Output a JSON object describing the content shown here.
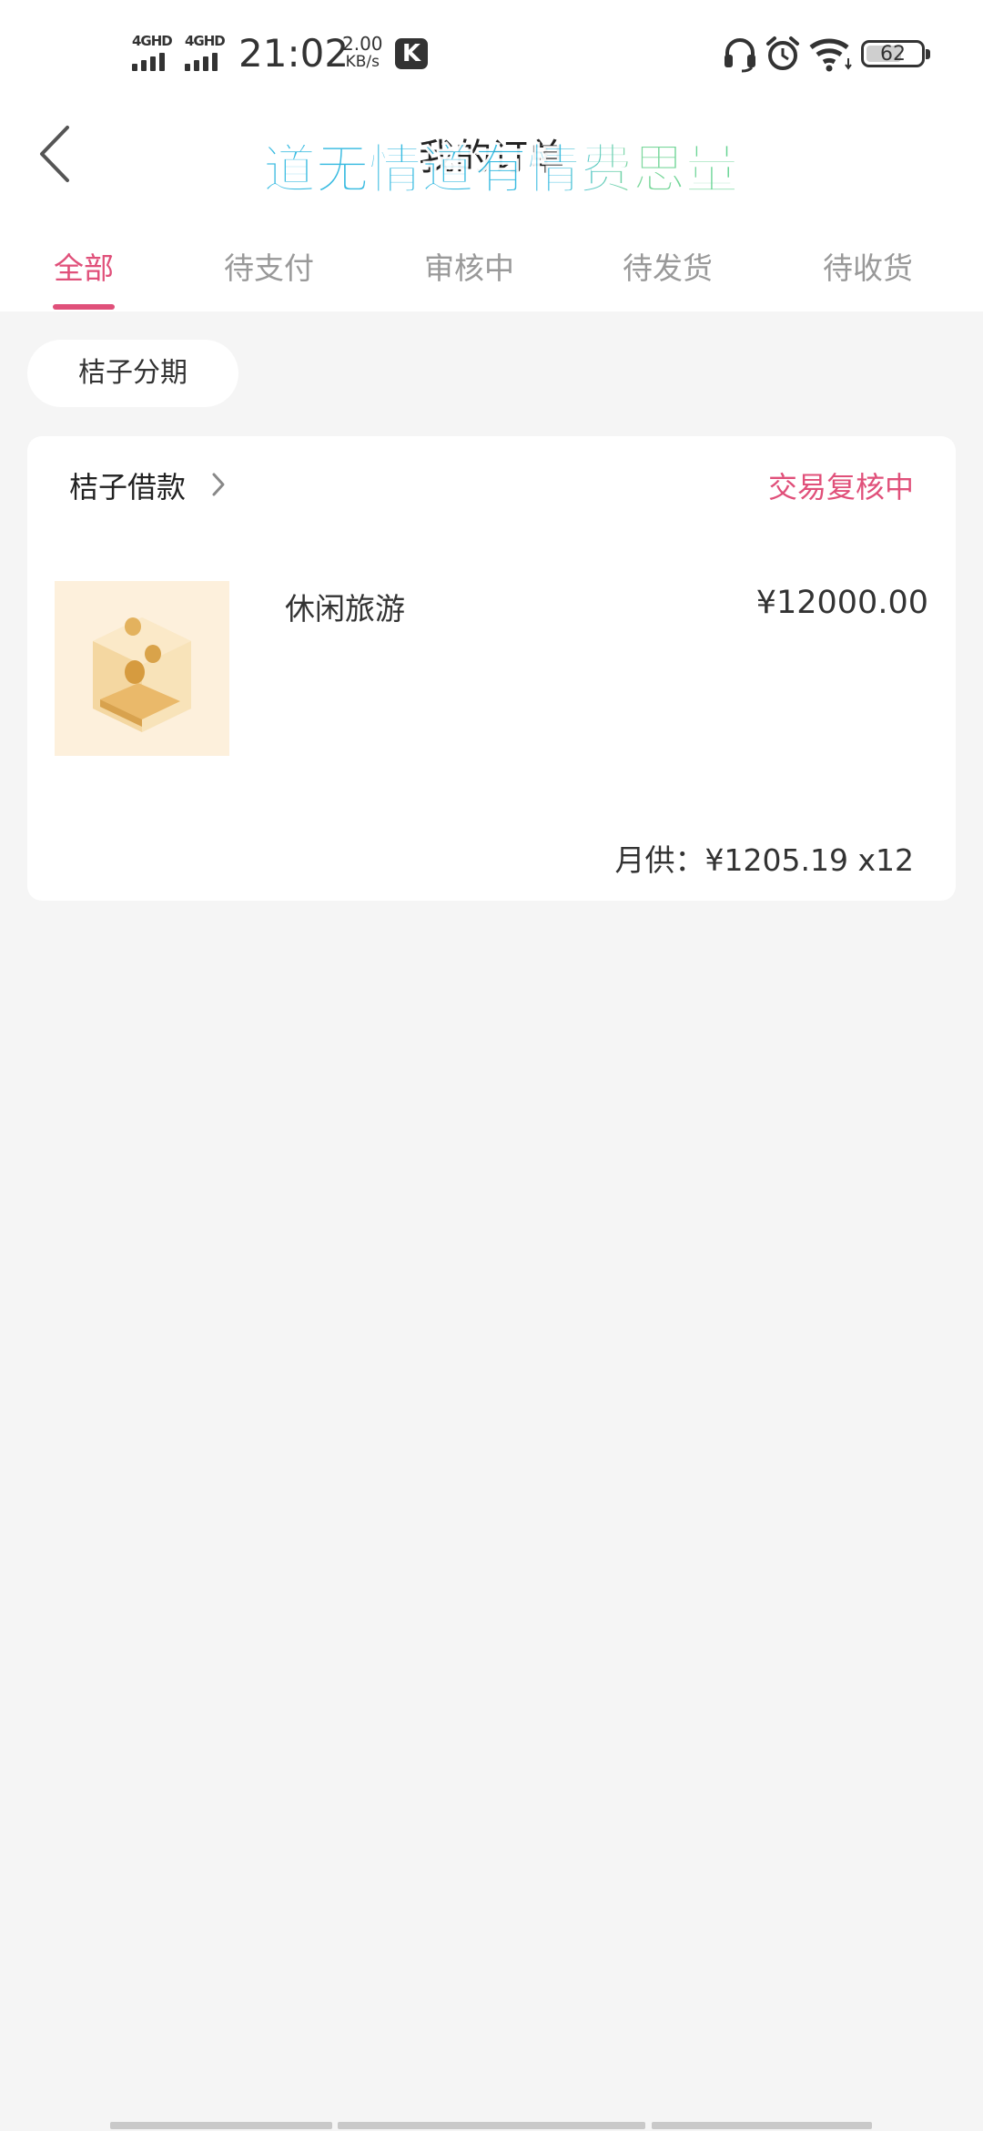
{
  "status_bar": {
    "sim1": "4GHD",
    "sim2": "4GHD",
    "time": "21:02",
    "speed_value": "2.00",
    "speed_unit": "KB/s",
    "app_badge": "K",
    "battery": "62",
    "icons": [
      "headset-icon",
      "alarm-icon",
      "wifi-icon"
    ]
  },
  "header": {
    "title": "我的订单",
    "watermark": "道无情道有情费思量"
  },
  "tabs": [
    {
      "label": "全部",
      "active": true
    },
    {
      "label": "待支付",
      "active": false
    },
    {
      "label": "审核中",
      "active": false
    },
    {
      "label": "待发货",
      "active": false
    },
    {
      "label": "待收货",
      "active": false
    }
  ],
  "filter": {
    "label": "桔子分期"
  },
  "order": {
    "merchant": "桔子借款",
    "status": "交易复核中",
    "item_name": "休闲旅游",
    "price": "¥12000.00",
    "monthly": "月供：¥1205.19 x12"
  },
  "colors": {
    "accent": "#e0507a",
    "background": "#f5f5f5",
    "card": "#ffffff",
    "watermark_blue": "#2fb8e0",
    "watermark_green": "#58d08a"
  }
}
